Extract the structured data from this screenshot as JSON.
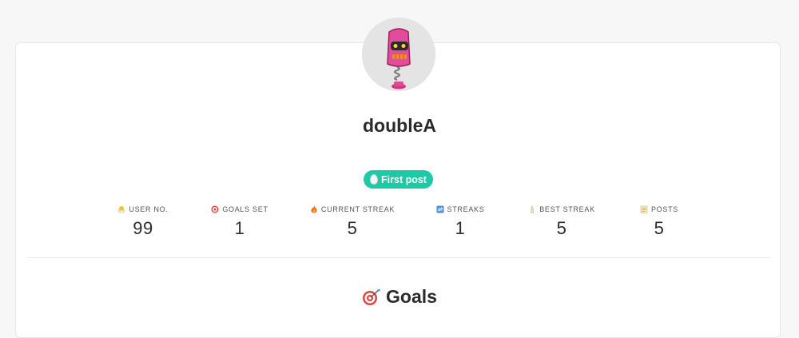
{
  "profile": {
    "username": "doubleA",
    "avatar_icon": "pink-robot-avatar"
  },
  "badge": {
    "label": "First post",
    "icon": "egg-icon",
    "color": "#1ec9a6"
  },
  "stats": [
    {
      "label": "USER NO.",
      "value": "99",
      "icon": "hatching-chick-icon"
    },
    {
      "label": "GOALS SET",
      "value": "1",
      "icon": "target-icon"
    },
    {
      "label": "CURRENT STREAK",
      "value": "5",
      "icon": "fire-icon"
    },
    {
      "label": "STREAKS",
      "value": "1",
      "icon": "repeat-icon"
    },
    {
      "label": "BEST STREAK",
      "value": "5",
      "icon": "candle-icon"
    },
    {
      "label": "POSTS",
      "value": "5",
      "icon": "memo-icon"
    }
  ],
  "sections": {
    "goals_title": "Goals",
    "goals_icon": "target-icon"
  }
}
